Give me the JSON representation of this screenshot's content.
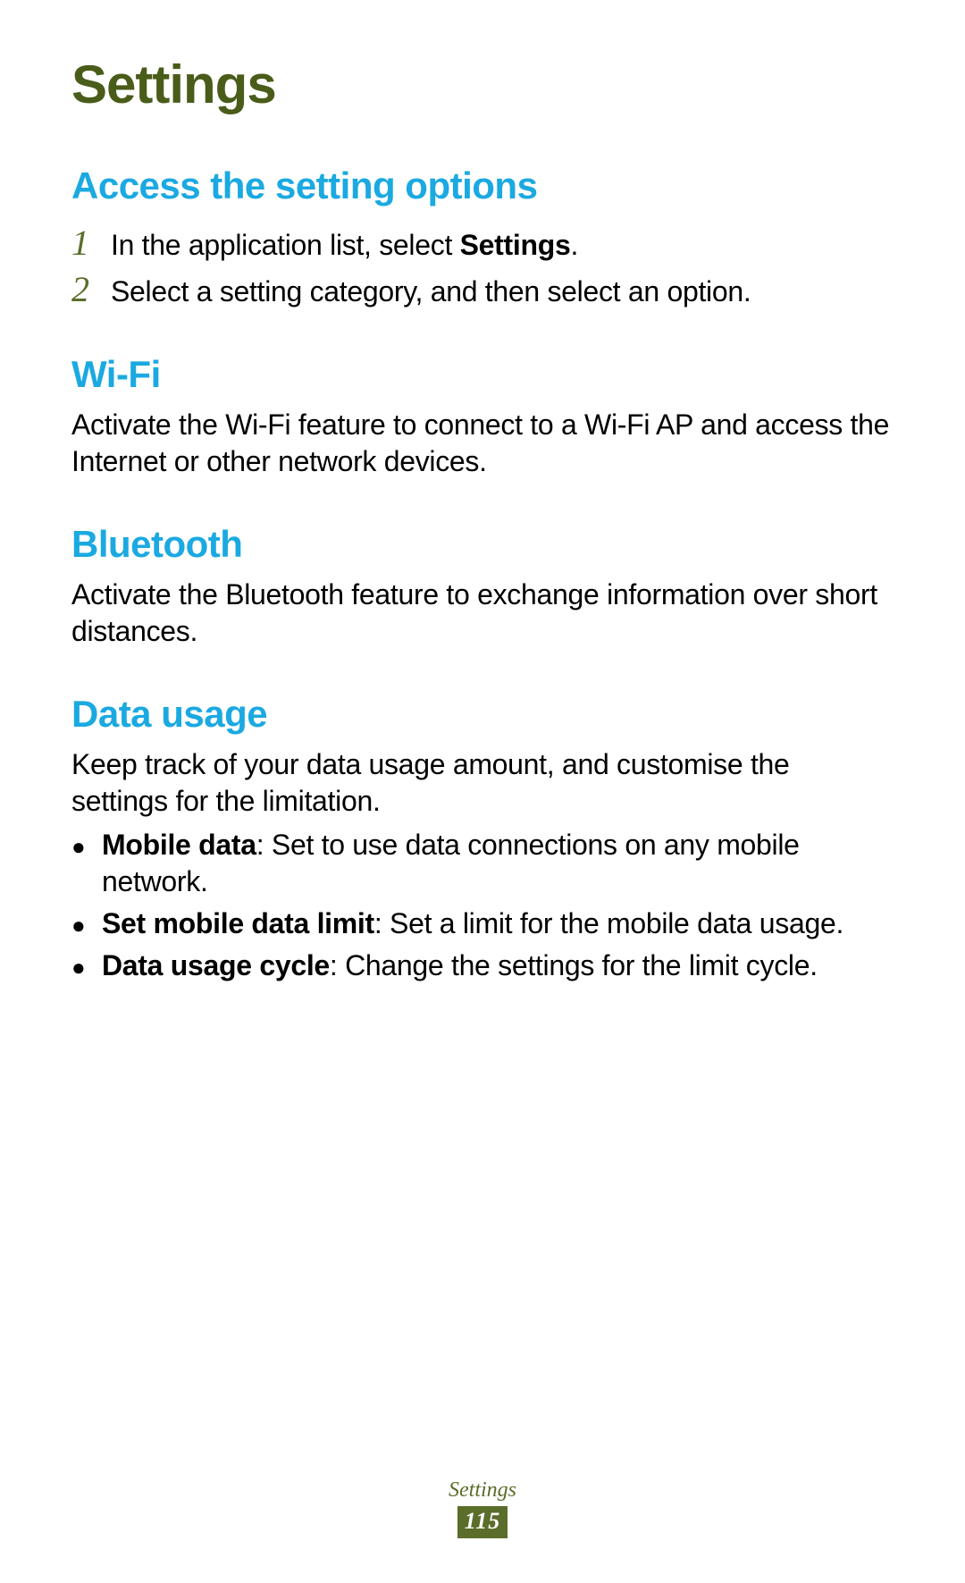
{
  "title": "Settings",
  "section1": {
    "heading": "Access the setting options",
    "steps": [
      {
        "num": "1",
        "pre": "In the application list, select ",
        "bold": "Settings",
        "post": "."
      },
      {
        "num": "2",
        "pre": "Select a setting category, and then select an option.",
        "bold": "",
        "post": ""
      }
    ]
  },
  "section2": {
    "heading": "Wi-Fi",
    "body": "Activate the Wi-Fi feature to connect to a Wi-Fi AP and access the Internet or other network devices."
  },
  "section3": {
    "heading": "Bluetooth",
    "body": "Activate the Bluetooth feature to exchange information over short distances."
  },
  "section4": {
    "heading": "Data usage",
    "body": "Keep track of your data usage amount, and customise the settings for the limitation.",
    "bullets": [
      {
        "bold": "Mobile data",
        "text": ": Set to use data connections on any mobile network."
      },
      {
        "bold": "Set mobile data limit",
        "text": ": Set a limit for the mobile data usage."
      },
      {
        "bold": "Data usage cycle",
        "text": ": Change the settings for the limit cycle."
      }
    ]
  },
  "footer": {
    "label": "Settings",
    "page": "115"
  }
}
